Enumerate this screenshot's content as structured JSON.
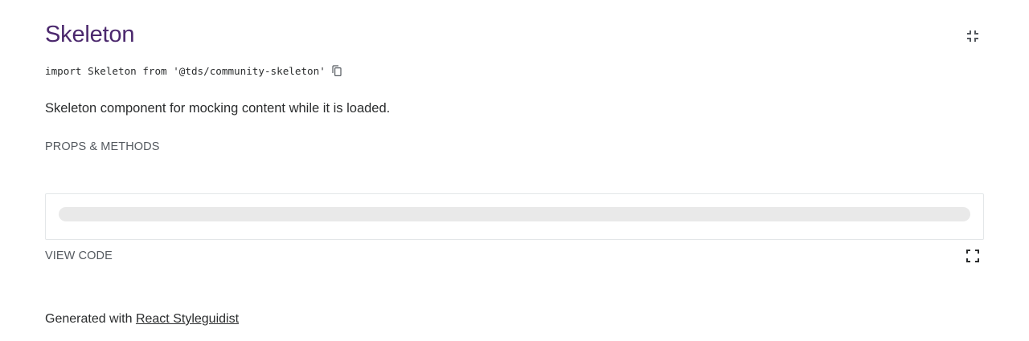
{
  "component": {
    "title": "Skeleton",
    "import_statement": "import Skeleton from '@tds/community-skeleton'",
    "description": "Skeleton component for mocking content while it is loaded.",
    "props_link_label": "PROPS & METHODS",
    "view_code_label": "VIEW CODE",
    "icons": {
      "isolate": "collapse-icon",
      "copy": "copy-icon",
      "fullscreen": "fullscreen-icon"
    }
  },
  "footer": {
    "prefix": "Generated with ",
    "link_label": "React Styleguidist"
  },
  "colors": {
    "title": "#4b286d",
    "text": "#2a2c2d",
    "muted": "#54595f",
    "skeleton": "#e9e9e9",
    "border": "#e3e6e8"
  }
}
